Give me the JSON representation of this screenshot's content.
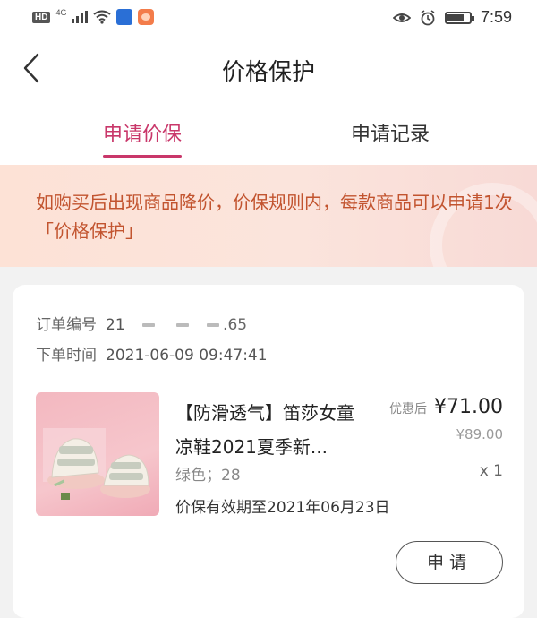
{
  "status_bar": {
    "hd": "HD",
    "network": "4G",
    "time": "7:59"
  },
  "header": {
    "title": "价格保护"
  },
  "tabs": [
    {
      "label": "申请价保",
      "active": true
    },
    {
      "label": "申请记录",
      "active": false
    }
  ],
  "notice": {
    "text": "如购买后出现商品降价，价保规则内，每款商品可以申请1次「价格保护」"
  },
  "order": {
    "number_label": "订单编号",
    "number_prefix": "21",
    "number_suffix": ".65",
    "time_label": "下单时间",
    "time_value": "2021-06-09 09:47:41",
    "product_name": "【防滑透气】笛莎女童凉鞋2021夏季新...",
    "spec": "绿色；28",
    "validity": "价保有效期至2021年06月23日",
    "price_label": "优惠后",
    "price": "¥71.00",
    "original_price": "¥89.00",
    "quantity": "x 1",
    "apply_button": "申请"
  },
  "colors": {
    "accent": "#c9376a",
    "notice_text": "#c2542f"
  },
  "icons": {
    "back": "chevron-left-icon",
    "eye": "eye-icon",
    "alarm": "alarm-icon",
    "battery": "battery-icon",
    "wifi": "wifi-icon"
  }
}
